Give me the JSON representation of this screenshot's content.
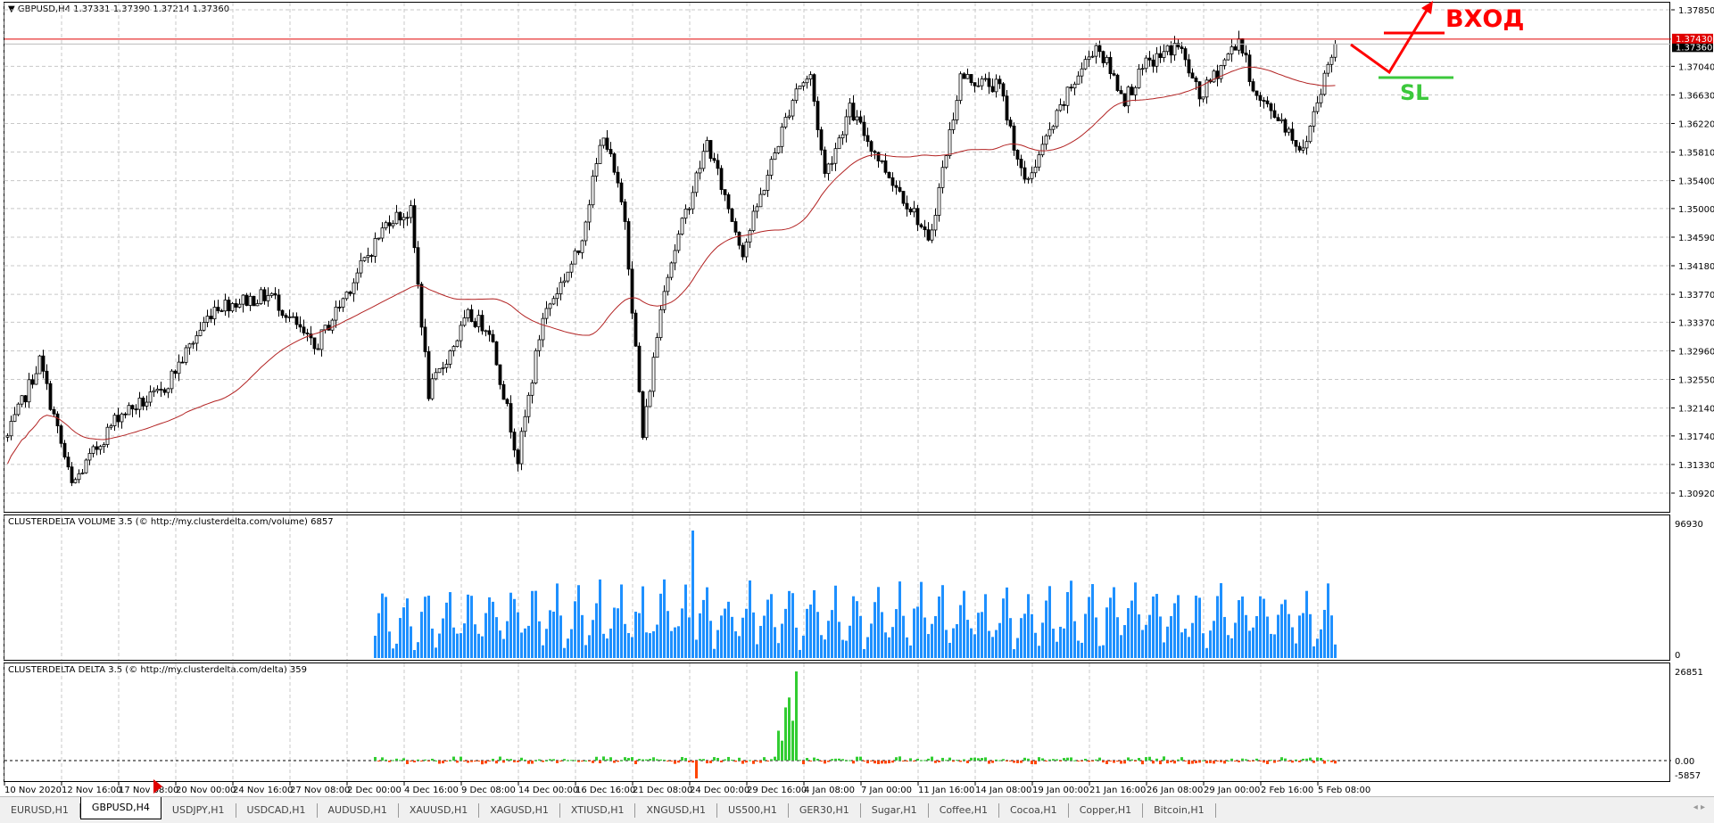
{
  "header": {
    "symbol": "GBPUSD,H4",
    "ohlc": "1.37331 1.37390 1.37214 1.37360"
  },
  "price_axis": {
    "labels": [
      "1.37850",
      "1.37040",
      "1.36630",
      "1.36220",
      "1.35810",
      "1.35400",
      "1.35000",
      "1.34590",
      "1.34180",
      "1.33770",
      "1.33370",
      "1.32960",
      "1.32550",
      "1.32140",
      "1.31740",
      "1.31330",
      "1.30920"
    ],
    "min": 1.3092,
    "max": 1.3785,
    "alert_line": "1.37430",
    "current_price": "1.37360",
    "alert_color": "#e00000"
  },
  "time_axis": {
    "labels": [
      "10 Nov 2020",
      "12 Nov 16:00",
      "17 Nov 08:00",
      "20 Nov 00:00",
      "24 Nov 16:00",
      "27 Nov 08:00",
      "2 Dec 00:00",
      "4 Dec 16:00",
      "9 Dec 08:00",
      "14 Dec 00:00",
      "16 Dec 16:00",
      "21 Dec 08:00",
      "24 Dec 00:00",
      "29 Dec 16:00",
      "4 Jan 08:00",
      "7 Jan 00:00",
      "11 Jan 16:00",
      "14 Jan 08:00",
      "19 Jan 00:00",
      "21 Jan 16:00",
      "26 Jan 08:00",
      "29 Jan 00:00",
      "2 Feb 16:00",
      "5 Feb 08:00"
    ]
  },
  "annotations": {
    "entry_label": "ВХОД",
    "sl_label": "SL",
    "entry_color": "#ff0000",
    "sl_color": "#3cc83c"
  },
  "volume_pane": {
    "title": "CLUSTERDELTA VOLUME 3.5 (© http://my.clusterdelta.com/volume) 6857",
    "max_label": "96930",
    "min_label": "0",
    "max": 96930,
    "bar_color": "#1e90ff"
  },
  "delta_pane": {
    "title": "CLUSTERDELTA DELTA 3.5 (© http://my.clusterdelta.com/delta) 359",
    "max_label": "26851",
    "zero_label": "0.00",
    "min_label": "-5857",
    "max": 26851,
    "min": -5857,
    "pos_color": "#32cd32",
    "neg_color": "#ff4500"
  },
  "chart_data": {
    "type": "candlestick",
    "title": "GBPUSD,H4",
    "bars": 373,
    "ma_period": 50,
    "ma_color": "#b22222",
    "price_path": [
      [
        0,
        1.3172
      ],
      [
        9,
        1.3282
      ],
      [
        18,
        1.3102
      ],
      [
        31,
        1.3204
      ],
      [
        43,
        1.3235
      ],
      [
        58,
        1.336
      ],
      [
        74,
        1.3376
      ],
      [
        86,
        1.3298
      ],
      [
        98,
        1.3407
      ],
      [
        107,
        1.3486
      ],
      [
        113,
        1.3494
      ],
      [
        118,
        1.3235
      ],
      [
        129,
        1.3345
      ],
      [
        135,
        1.3329
      ],
      [
        143,
        1.3141
      ],
      [
        150,
        1.3345
      ],
      [
        160,
        1.3439
      ],
      [
        167,
        1.3611
      ],
      [
        173,
        1.3486
      ],
      [
        178,
        1.3172
      ],
      [
        184,
        1.3392
      ],
      [
        196,
        1.3595
      ],
      [
        206,
        1.3439
      ],
      [
        221,
        1.3674
      ],
      [
        225,
        1.3689
      ],
      [
        229,
        1.3548
      ],
      [
        236,
        1.3642
      ],
      [
        245,
        1.3564
      ],
      [
        255,
        1.3486
      ],
      [
        258,
        1.3447
      ],
      [
        267,
        1.3689
      ],
      [
        278,
        1.3674
      ],
      [
        285,
        1.3533
      ],
      [
        298,
        1.3674
      ],
      [
        305,
        1.3736
      ],
      [
        313,
        1.3658
      ],
      [
        319,
        1.3705
      ],
      [
        328,
        1.3736
      ],
      [
        334,
        1.3658
      ],
      [
        345,
        1.3744
      ],
      [
        350,
        1.3658
      ],
      [
        357,
        1.3627
      ],
      [
        363,
        1.358
      ],
      [
        367,
        1.3658
      ],
      [
        372,
        1.3736
      ]
    ],
    "volume_start_bar": 103,
    "volume_spike_bar": 192,
    "delta_spike_bars": [
      216,
      217,
      218,
      219,
      220,
      221
    ]
  },
  "tabs": [
    "EURUSD,H1",
    "GBPUSD,H4",
    "USDJPY,H1",
    "USDCAD,H1",
    "AUDUSD,H1",
    "XAUUSD,H1",
    "XAGUSD,H1",
    "XTIUSD,H1",
    "XNGUSD,H1",
    "US500,H1",
    "GER30,H1",
    "Sugar,H1",
    "Coffee,H1",
    "Cocoa,H1",
    "Copper,H1",
    "Bitcoin,H1"
  ],
  "active_tab": 1
}
